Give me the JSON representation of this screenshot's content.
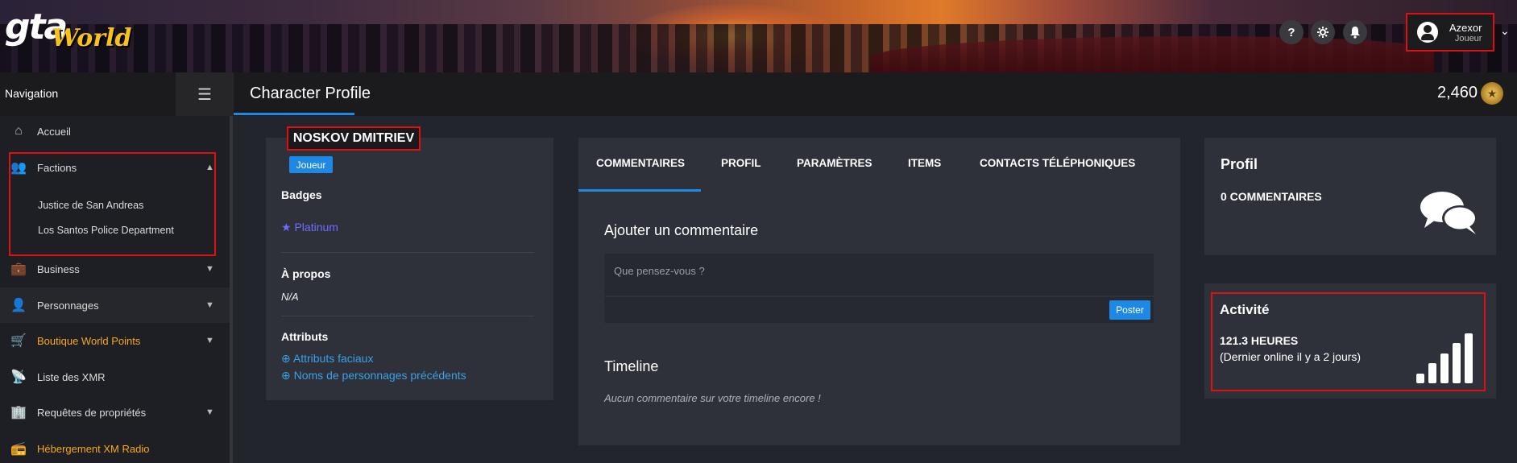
{
  "header": {
    "logo_main": "gta",
    "logo_sub": "World",
    "icons": [
      "help-icon",
      "settings-icon",
      "bell-icon"
    ],
    "help_glyph": "?",
    "user": {
      "name": "Azexor",
      "role": "Joueur"
    }
  },
  "topbar": {
    "navigation_label": "Navigation",
    "page_title": "Character Profile",
    "points": "2,460"
  },
  "sidebar": {
    "items": [
      {
        "label": "Accueil",
        "icon": "home-icon"
      },
      {
        "label": "Factions",
        "icon": "users-icon",
        "expanded": true,
        "children": [
          "Justice de San Andreas",
          "Los Santos Police Department"
        ]
      },
      {
        "label": "Business",
        "icon": "briefcase-icon"
      },
      {
        "label": "Personnages",
        "icon": "user-icon"
      },
      {
        "label": "Boutique World Points",
        "icon": "cart-icon",
        "highlight": "#f7a81a"
      },
      {
        "label": "Liste des XMR",
        "icon": "antenna-icon"
      },
      {
        "label": "Requêtes de propriétés",
        "icon": "building-icon"
      },
      {
        "label": "Hébergement XM Radio",
        "icon": "radio-icon",
        "highlight": "#f7a81a"
      }
    ]
  },
  "character": {
    "name": "NOSKOV DMITRIEV",
    "role": "Joueur",
    "badges_title": "Badges",
    "badge": "Platinum",
    "about_title": "À propos",
    "about_value": "N/A",
    "attributes_title": "Attributs",
    "attributes_links": [
      "Attributs faciaux",
      "Noms de personnages précédents"
    ]
  },
  "tabs": [
    "COMMENTAIRES",
    "PROFIL",
    "PARAMÈTRES",
    "ITEMS",
    "CONTACTS TÉLÉPHONIQUES"
  ],
  "comments": {
    "add_title": "Ajouter un commentaire",
    "placeholder": "Que pensez-vous ?",
    "post_label": "Poster",
    "timeline_title": "Timeline",
    "timeline_empty": "Aucun commentaire sur votre timeline encore !"
  },
  "profile_card": {
    "title": "Profil",
    "count": "0 COMMENTAIRES"
  },
  "activity": {
    "title": "Activité",
    "hours": "121.3 HEURES",
    "last_online": "(Dernier online il y a 2 jours)",
    "bar_levels": [
      0.2,
      0.4,
      0.6,
      0.8,
      1.0
    ]
  },
  "colors": {
    "accent": "#1e88e5",
    "gold": "#f7a81a",
    "highlight_box": "#dd1111"
  }
}
